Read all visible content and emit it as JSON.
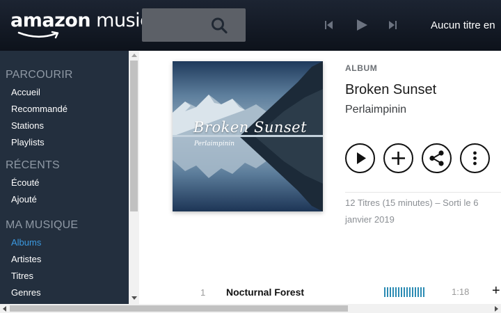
{
  "header": {
    "logo_word1": "amazon",
    "logo_word2": "music",
    "search": {
      "value": "",
      "placeholder": ""
    },
    "now_playing": "Aucun titre en"
  },
  "sidebar": {
    "sections": [
      {
        "title": "PARCOURIR",
        "items": [
          "Accueil",
          "Recommandé",
          "Stations",
          "Playlists"
        ]
      },
      {
        "title": "RÉCENTS",
        "items": [
          "Écouté",
          "Ajouté"
        ]
      },
      {
        "title": "MA MUSIQUE",
        "items": [
          "Albums",
          "Artistes",
          "Titres",
          "Genres"
        ]
      }
    ],
    "active_item": "Albums"
  },
  "album": {
    "label": "ALBUM",
    "title": "Broken Sunset",
    "artist": "Perlaimpinin",
    "cover_title": "Broken Sunset",
    "cover_artist": "Perlaimpinin",
    "meta": "12 Titres (15 minutes) – Sorti le 6 janvier 2019"
  },
  "actions": [
    {
      "icon": "play-icon"
    },
    {
      "icon": "plus-icon"
    },
    {
      "icon": "share-icon"
    },
    {
      "icon": "more-vertical-icon"
    }
  ],
  "tracks": [
    {
      "number": "1",
      "title": "Nocturnal Forest",
      "duration": "1:18"
    }
  ],
  "colors": {
    "header_bg": "#131a24",
    "sidebar_bg": "#232f3e",
    "active_link": "#3b9ae1",
    "popularity_bar": "#2b8bb3"
  }
}
